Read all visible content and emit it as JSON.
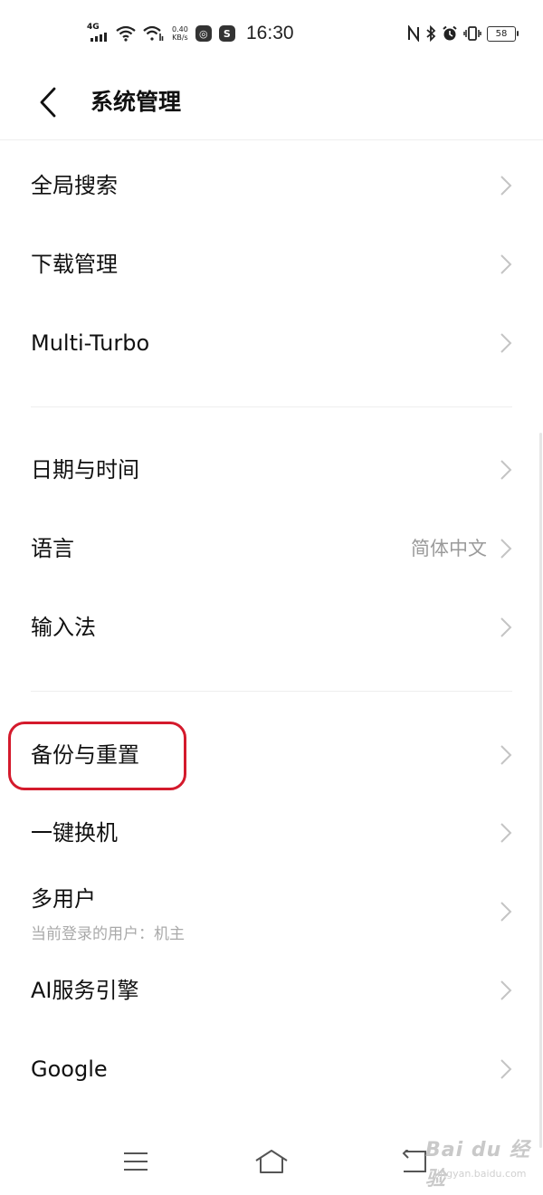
{
  "status_bar": {
    "network": "4G",
    "speed_value": "0.40",
    "speed_unit": "KB/s",
    "time": "16:30",
    "battery": "58",
    "icons": [
      "signal-icon",
      "wifi-icon",
      "wifi-data-icon",
      "app-notification-icon",
      "sync-icon",
      "nfc-icon",
      "bluetooth-icon",
      "alarm-icon",
      "vibrate-icon",
      "battery-icon"
    ]
  },
  "header": {
    "title": "系统管理",
    "back_icon": "chevron-left-icon"
  },
  "groups": [
    {
      "items": [
        {
          "label": "全局搜索"
        },
        {
          "label": "下载管理"
        },
        {
          "label": "Multi-Turbo"
        }
      ]
    },
    {
      "items": [
        {
          "label": "日期与时间"
        },
        {
          "label": "语言",
          "value": "简体中文"
        },
        {
          "label": "输入法"
        }
      ]
    },
    {
      "items": [
        {
          "label": "备份与重置",
          "highlighted": true
        },
        {
          "label": "一键换机"
        },
        {
          "label": "多用户",
          "sub": "当前登录的用户：机主"
        },
        {
          "label": "AI服务引擎"
        },
        {
          "label": "Google"
        }
      ]
    }
  ],
  "nav_bar": {
    "icons": [
      "menu-icon",
      "home-icon",
      "back-icon"
    ]
  },
  "watermark": {
    "text": "Bai du 经验",
    "sub": "jingyan.baidu.com"
  },
  "colors": {
    "highlight": "#d41a2c",
    "divider": "#eeeeee",
    "secondary_text": "#9a9a9a"
  }
}
